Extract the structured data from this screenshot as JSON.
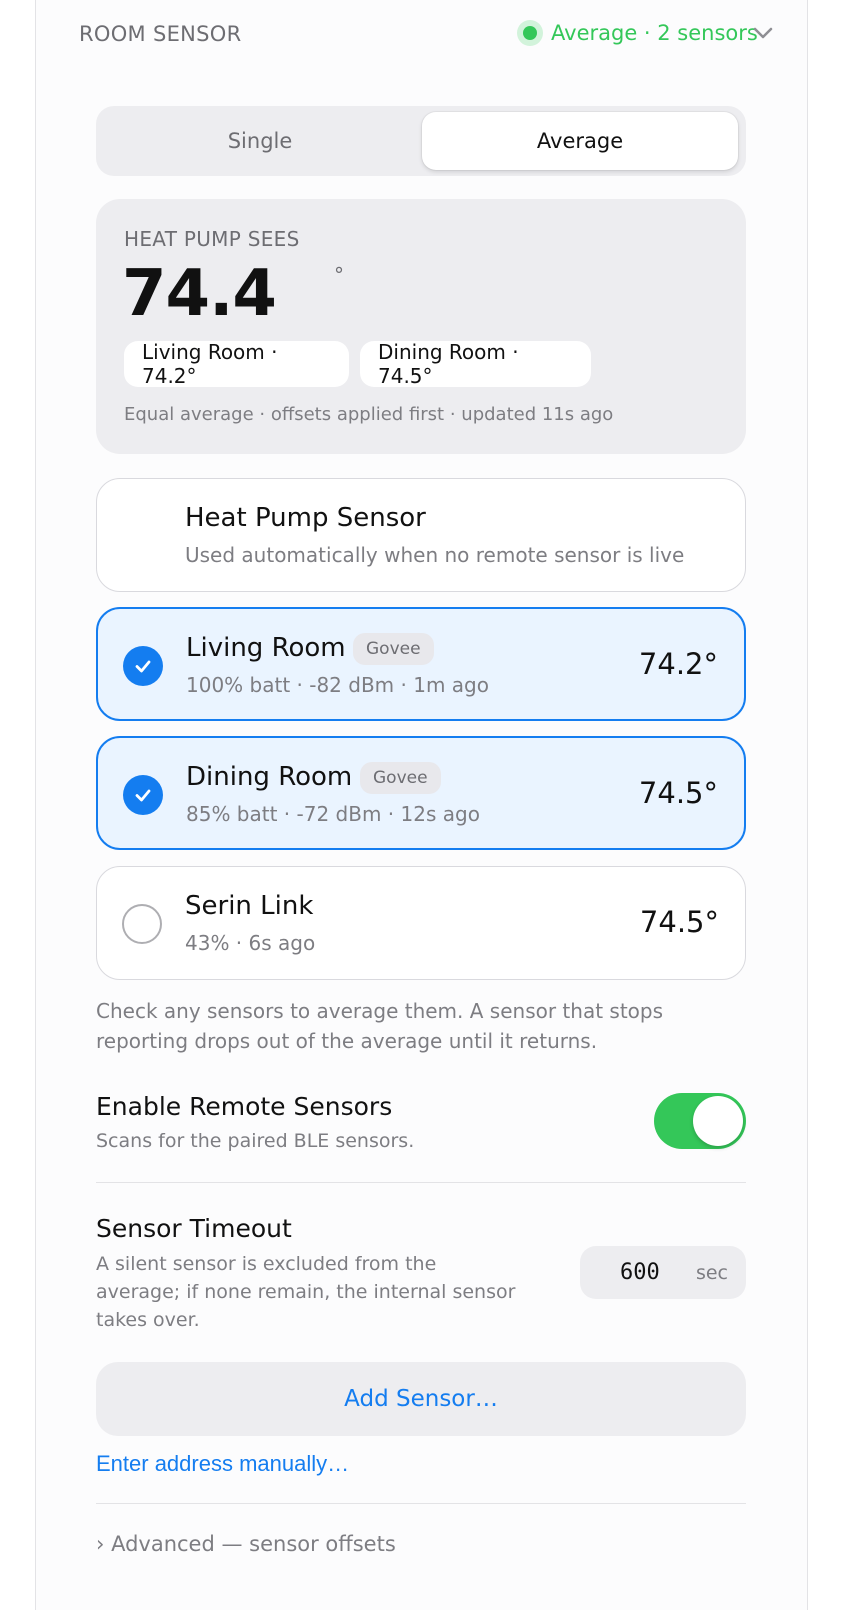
{
  "header": {
    "title": "ROOM SENSOR",
    "status": "Average · 2 sensors",
    "status_color": "#34c759"
  },
  "mode": {
    "options": [
      "Single",
      "Average"
    ],
    "selected": "Average"
  },
  "heat_pump_sees": {
    "label": "HEAT PUMP SEES",
    "temperature": "74.4",
    "degree": "°",
    "chips": [
      "Living Room · 74.2°",
      "Dining Room · 74.5°"
    ],
    "footnote": "Equal average · offsets applied first · updated 11s ago"
  },
  "sensors": [
    {
      "name": "Heat Pump Sensor",
      "subtitle": "Used automatically when no remote sensor is live"
    },
    {
      "name": "Living Room",
      "badge": "Govee",
      "subtitle": "100% batt · -82 dBm · 1m ago",
      "temperature": "74.2°",
      "selected": true
    },
    {
      "name": "Dining Room",
      "badge": "Govee",
      "subtitle": "85% batt · -72 dBm · 12s ago",
      "temperature": "74.5°",
      "selected": true
    },
    {
      "name": "Serin Link",
      "subtitle": "43% · 6s ago",
      "temperature": "74.5°",
      "selected": false
    }
  ],
  "help_text": "Check any sensors to average them. A sensor that stops reporting drops out of the average until it returns.",
  "remote_sensors": {
    "title": "Enable Remote Sensors",
    "subtitle": "Scans for the paired BLE sensors.",
    "enabled": true
  },
  "timeout": {
    "title": "Sensor Timeout",
    "description": "A silent sensor is excluded from the average; if none remain, the internal sensor takes over.",
    "value": "600",
    "unit": "sec"
  },
  "add_sensor_label": "Add Sensor…",
  "manual_link_label": "Enter address manually…",
  "advanced_label": "› Advanced — sensor offsets",
  "colors": {
    "accent": "#147df0",
    "success": "#34c759",
    "selected_bg": "#eaf4ff"
  }
}
